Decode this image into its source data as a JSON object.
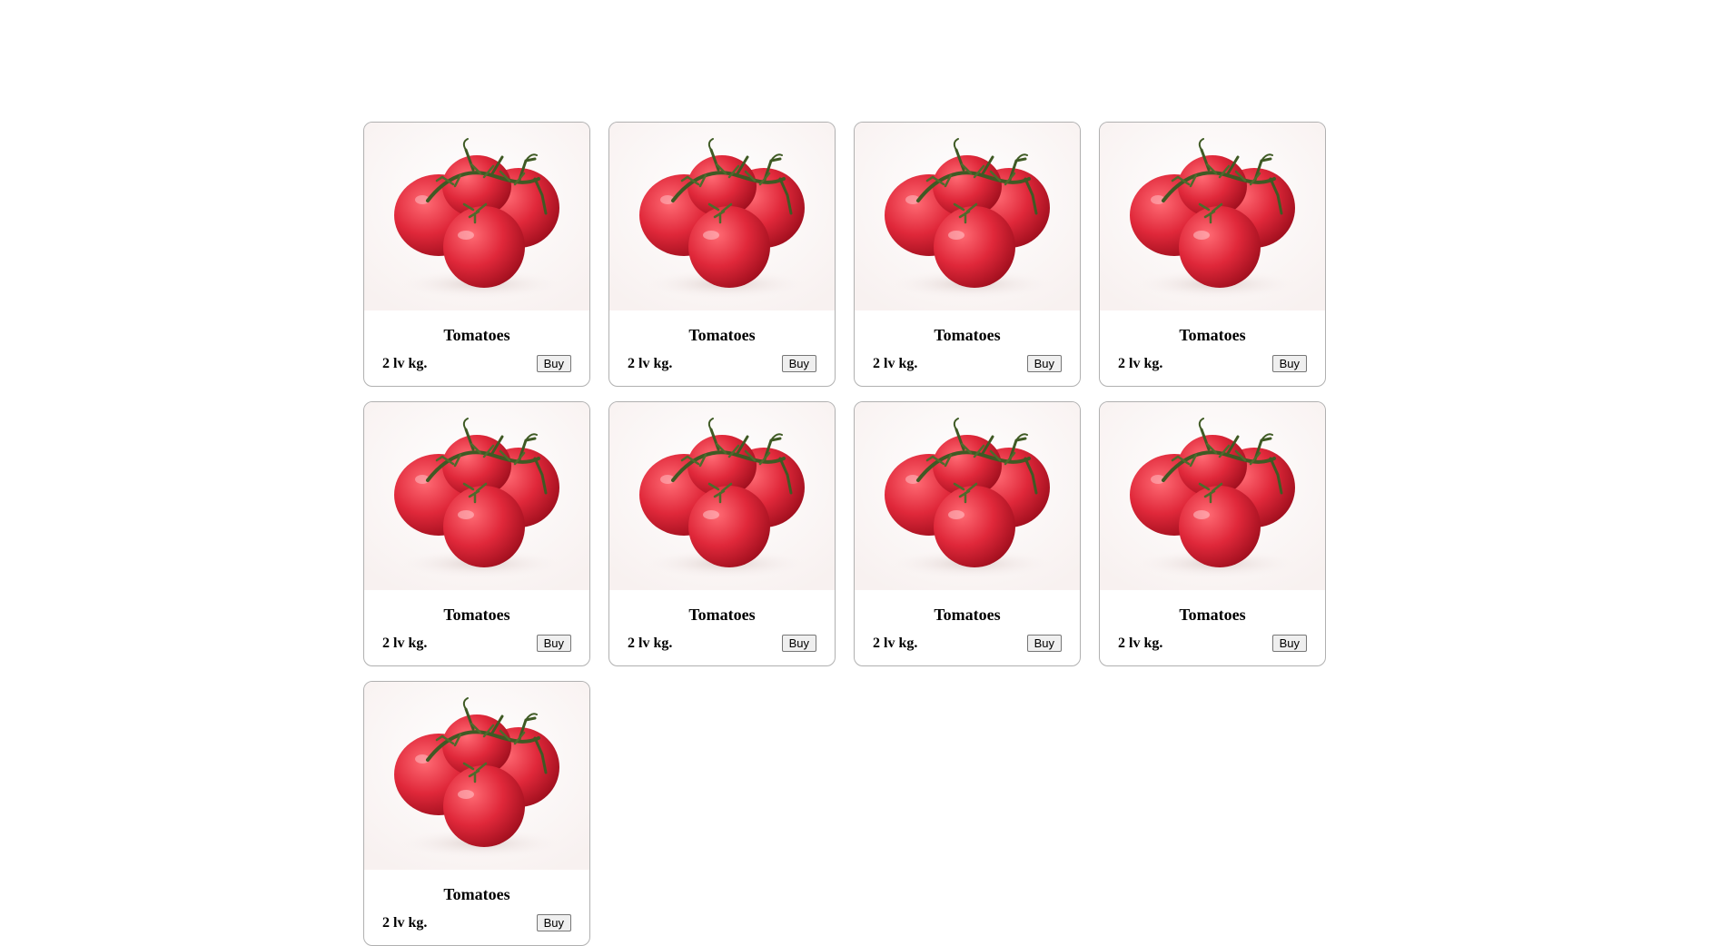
{
  "products": [
    {
      "name": "Tomatoes",
      "price": "2 lv kg.",
      "buy_label": "Buy",
      "image_icon": "tomatoes-image"
    },
    {
      "name": "Tomatoes",
      "price": "2 lv kg.",
      "buy_label": "Buy",
      "image_icon": "tomatoes-image"
    },
    {
      "name": "Tomatoes",
      "price": "2 lv kg.",
      "buy_label": "Buy",
      "image_icon": "tomatoes-image"
    },
    {
      "name": "Tomatoes",
      "price": "2 lv kg.",
      "buy_label": "Buy",
      "image_icon": "tomatoes-image"
    },
    {
      "name": "Tomatoes",
      "price": "2 lv kg.",
      "buy_label": "Buy",
      "image_icon": "tomatoes-image"
    },
    {
      "name": "Tomatoes",
      "price": "2 lv kg.",
      "buy_label": "Buy",
      "image_icon": "tomatoes-image"
    },
    {
      "name": "Tomatoes",
      "price": "2 lv kg.",
      "buy_label": "Buy",
      "image_icon": "tomatoes-image"
    },
    {
      "name": "Tomatoes",
      "price": "2 lv kg.",
      "buy_label": "Buy",
      "image_icon": "tomatoes-image"
    },
    {
      "name": "Tomatoes",
      "price": "2 lv kg.",
      "buy_label": "Buy",
      "image_icon": "tomatoes-image"
    }
  ],
  "colors": {
    "tomato": "#e0283a",
    "vine": "#3f5a24",
    "image_bg": "#f8f1f0"
  }
}
